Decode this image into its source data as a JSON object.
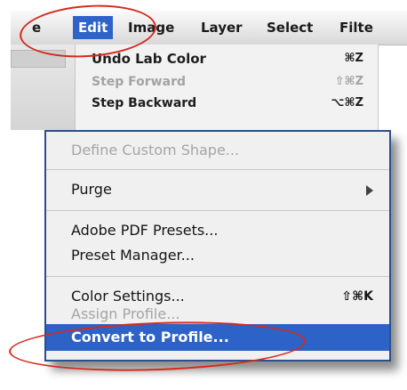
{
  "menubar": {
    "items": [
      {
        "label": "e",
        "active": false
      },
      {
        "label": "Edit",
        "active": true
      },
      {
        "label": "Image",
        "active": false
      },
      {
        "label": "Layer",
        "active": false
      },
      {
        "label": "Select",
        "active": false
      },
      {
        "label": "Filte",
        "active": false
      }
    ],
    "active_color": "#2f63c9"
  },
  "edit_menu_top": {
    "items": [
      {
        "label": "Undo Lab Color",
        "shortcut": "⌘Z",
        "enabled": true
      },
      {
        "label": "Step Forward",
        "shortcut": "⇧⌘Z",
        "enabled": false
      },
      {
        "label": "Step Backward",
        "shortcut": "⌥⌘Z",
        "enabled": true
      }
    ]
  },
  "edit_menu_main": {
    "items": [
      {
        "label": "Define Custom Shape...",
        "shortcut": "",
        "enabled": false
      },
      {
        "label": "Purge",
        "shortcut": "",
        "enabled": true,
        "submenu": true
      },
      {
        "label": "Adobe PDF Presets...",
        "shortcut": "",
        "enabled": true
      },
      {
        "label": "Preset Manager...",
        "shortcut": "",
        "enabled": true
      },
      {
        "label": "Color Settings...",
        "shortcut": "⇧⌘K",
        "enabled": true
      },
      {
        "label": "Assign Profile...",
        "shortcut": "",
        "enabled": false
      },
      {
        "label": "Convert to Profile...",
        "shortcut": "",
        "enabled": true,
        "highlighted": true
      }
    ],
    "border_color": "#2a4f8c",
    "highlight_color": "#2d62c7"
  },
  "annotations": {
    "color": "#d62a1c"
  }
}
